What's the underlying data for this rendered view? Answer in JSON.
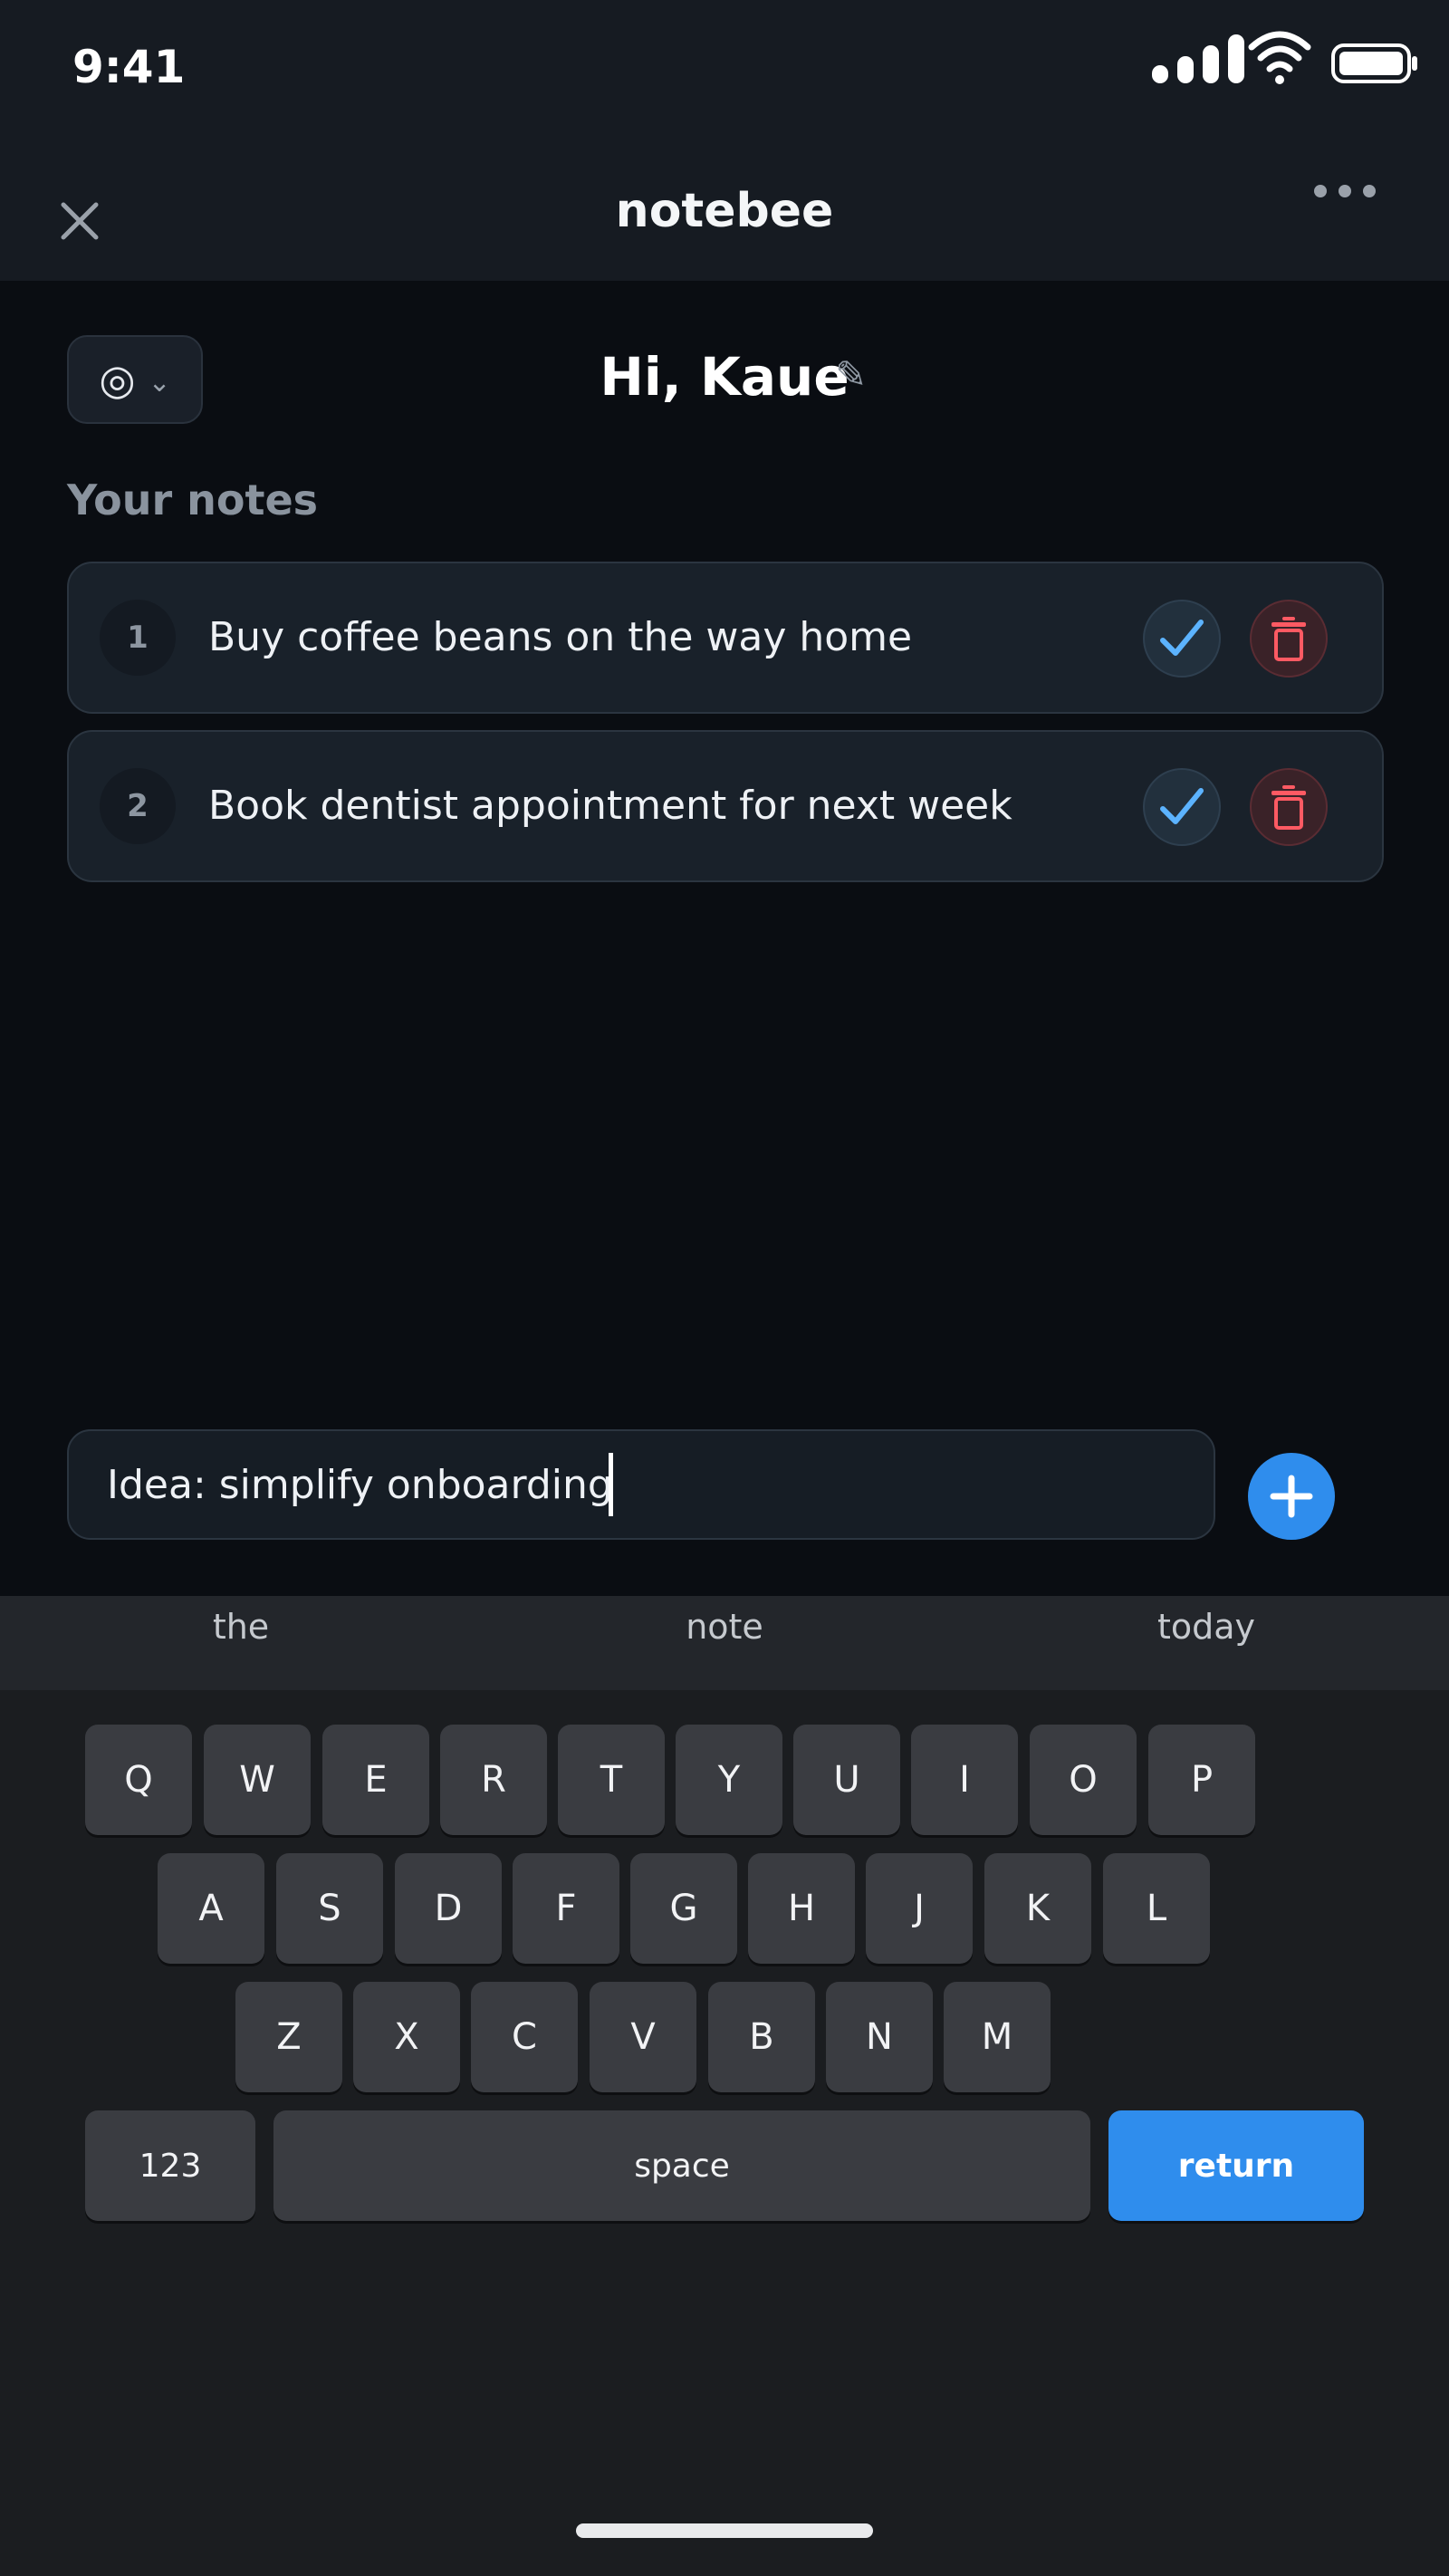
{
  "status_bar": {
    "time": "9:41"
  },
  "header": {
    "title": "notebee"
  },
  "greeting": {
    "text": "Hi, Kaue"
  },
  "mood_button": {
    "icon": "◎",
    "chevron": "⌄"
  },
  "section": {
    "title": "Your notes"
  },
  "notes": [
    {
      "number": "1",
      "text": "Buy coffee beans on the way home"
    },
    {
      "number": "2",
      "text": "Book dentist appointment for next week"
    }
  ],
  "composer": {
    "value": "Idea: simplify onboarding"
  },
  "keyboard": {
    "suggestions": [
      "the",
      "note",
      "today"
    ],
    "row1": [
      "Q",
      "W",
      "E",
      "R",
      "T",
      "Y",
      "U",
      "I",
      "O",
      "P"
    ],
    "row2": [
      "A",
      "S",
      "D",
      "F",
      "G",
      "H",
      "J",
      "K",
      "L"
    ],
    "row3": [
      "Z",
      "X",
      "C",
      "V",
      "B",
      "N",
      "M"
    ],
    "numbers_label": "123",
    "space_label": "space",
    "return_label": "return"
  },
  "colors": {
    "accent": "#2f8ded",
    "check": "#5cb3ff",
    "delete": "#ff5a63"
  }
}
